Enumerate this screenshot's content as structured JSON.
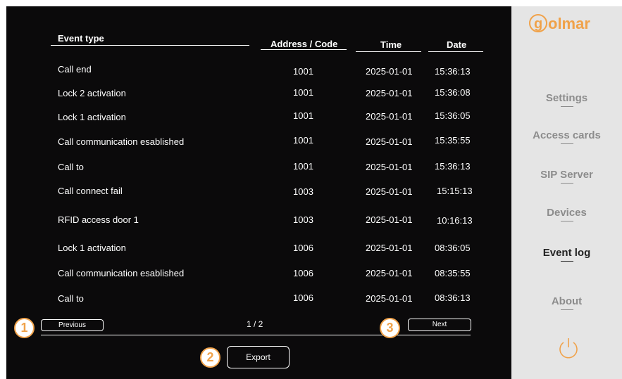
{
  "brand": {
    "logo_text": "golmar",
    "accent_color": "#f0a24a"
  },
  "table": {
    "headers": {
      "event_type": "Event type",
      "address": "Address / Code",
      "time": "Time",
      "date": "Date"
    },
    "rows": [
      {
        "event": "Call end",
        "code": "1001",
        "date": "2025-01-01",
        "time": "15:36:13"
      },
      {
        "event": "Lock 2 activation",
        "code": "1001",
        "date": "2025-01-01",
        "time": "15:36:08"
      },
      {
        "event": "Lock 1 activation",
        "code": "1001",
        "date": "2025-01-01",
        "time": "15:36:05"
      },
      {
        "event": "Call communication esablished",
        "code": "1001",
        "date": "2025-01-01",
        "time": "15:35:55"
      },
      {
        "event": "Call to",
        "code": "1001",
        "date": "2025-01-01",
        "time": "15:36:13"
      },
      {
        "event": "Call connect fail",
        "code": "1003",
        "date": "2025-01-01",
        "time": "15:15:13"
      },
      {
        "event": "RFID access door 1",
        "code": "1003",
        "date": "2025-01-01",
        "time": "10:16:13"
      },
      {
        "event": "Lock 1 activation",
        "code": "1006",
        "date": "2025-01-01",
        "time": "08:36:05"
      },
      {
        "event": "Call communication esablished",
        "code": "1006",
        "date": "2025-01-01",
        "time": "08:35:55"
      },
      {
        "event": "Call to",
        "code": "1006",
        "date": "2025-01-01",
        "time": "08:36:13"
      }
    ]
  },
  "pagination": {
    "previous_label": "Previous",
    "page_indicator": "1 / 2",
    "next_label": "Next"
  },
  "export_label": "Export",
  "callouts": [
    "1",
    "2",
    "3"
  ],
  "sidebar": {
    "items": [
      {
        "label": "Settings",
        "active": false
      },
      {
        "label": "Access cards",
        "active": false
      },
      {
        "label": "SIP Server",
        "active": false
      },
      {
        "label": "Devices",
        "active": false
      },
      {
        "label": "Event log",
        "active": true
      },
      {
        "label": "About",
        "active": false
      }
    ],
    "power_icon": "power-icon"
  }
}
